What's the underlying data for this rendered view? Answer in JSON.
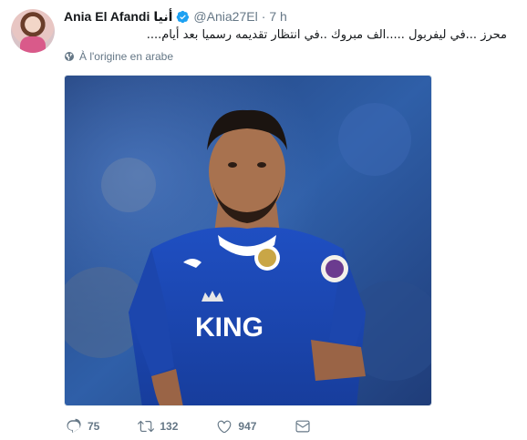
{
  "author": {
    "name": "Ania El Afandi",
    "name_arabic": "أنيا",
    "handle": "@Ania27El",
    "separator": "·",
    "time": "7 h"
  },
  "tweet": {
    "text": "محرز ...في ليفربول .....الف مبروك ..في انتظار تقديمه رسميا بعد أيام....",
    "translate_label": "À l'origine en arabe"
  },
  "media": {
    "jersey_text": "KING"
  },
  "actions": {
    "replies": "75",
    "retweets": "132",
    "likes": "947"
  },
  "icons": {
    "verified": "verified-badge-icon",
    "globe": "globe-icon",
    "reply": "reply-icon",
    "retweet": "retweet-icon",
    "like": "heart-icon",
    "message": "envelope-icon",
    "caret": "chevron-down-icon"
  },
  "colors": {
    "verified": "#1da1f2",
    "muted": "#657786",
    "text": "#14171a"
  }
}
